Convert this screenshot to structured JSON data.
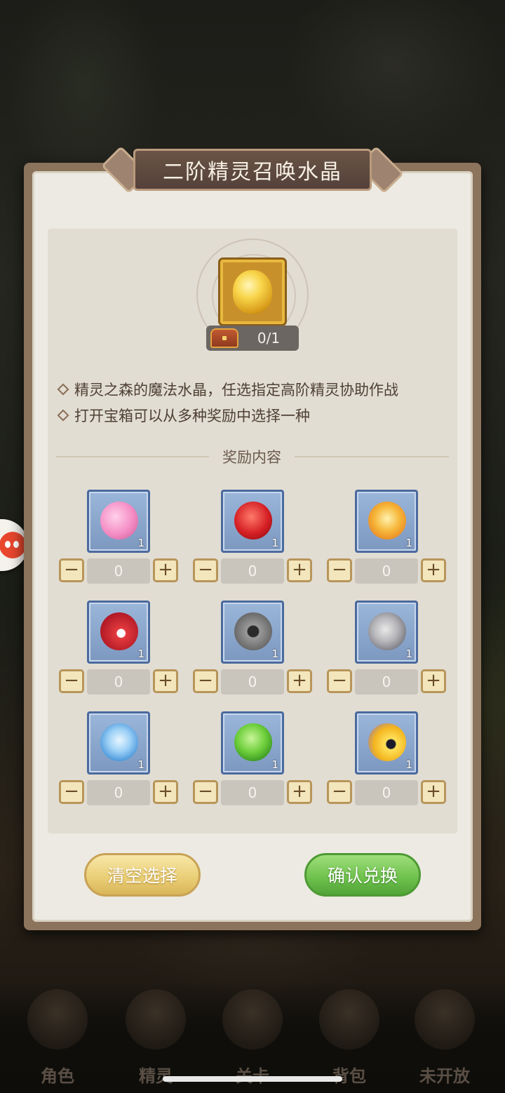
{
  "dialog": {
    "title": "二阶精灵召唤水晶",
    "owned_count": "0/1",
    "descriptions": [
      "精灵之森的魔法水晶，任选指定高阶精灵协助作战",
      "打开宝箱可以从多种奖励中选择一种"
    ],
    "section_title": "奖励内容",
    "rewards": [
      {
        "icon": "pink-fairy-wing-icon",
        "count": "1",
        "selected": "0",
        "minus": "−",
        "plus": "+"
      },
      {
        "icon": "red-flame-slime-icon",
        "count": "1",
        "selected": "0",
        "minus": "−",
        "plus": "+"
      },
      {
        "icon": "golden-trident-icon",
        "count": "1",
        "selected": "0",
        "minus": "−",
        "plus": "+"
      },
      {
        "icon": "red-spiky-creature-icon",
        "count": "1",
        "selected": "0",
        "minus": "−",
        "plus": "+"
      },
      {
        "icon": "grey-armored-beast-icon",
        "count": "1",
        "selected": "0",
        "minus": "−",
        "plus": "+"
      },
      {
        "icon": "grey-horned-beast-icon",
        "count": "1",
        "selected": "0",
        "minus": "−",
        "plus": "+"
      },
      {
        "icon": "ice-crystal-creature-icon",
        "count": "1",
        "selected": "0",
        "minus": "−",
        "plus": "+"
      },
      {
        "icon": "green-slime-icon",
        "count": "1",
        "selected": "0",
        "minus": "−",
        "plus": "+"
      },
      {
        "icon": "lightning-creature-icon",
        "count": "1",
        "selected": "0",
        "minus": "−",
        "plus": "+"
      }
    ],
    "clear_button": "清空选择",
    "confirm_button": "确认兑换"
  },
  "bottom_nav": [
    {
      "label": "角色",
      "icon": "character-icon"
    },
    {
      "label": "精灵",
      "icon": "spirit-icon"
    },
    {
      "label": "关卡",
      "icon": "stage-icon"
    },
    {
      "label": "背包",
      "icon": "backpack-icon"
    },
    {
      "label": "未开放",
      "icon": "locked-icon"
    }
  ],
  "colors": {
    "panel_border": "#8c735c",
    "title_banner": "#5e4a40",
    "item_frame": "#8aa6cc",
    "confirm_green": "#6dc04c",
    "clear_gold": "#e9cd74"
  }
}
